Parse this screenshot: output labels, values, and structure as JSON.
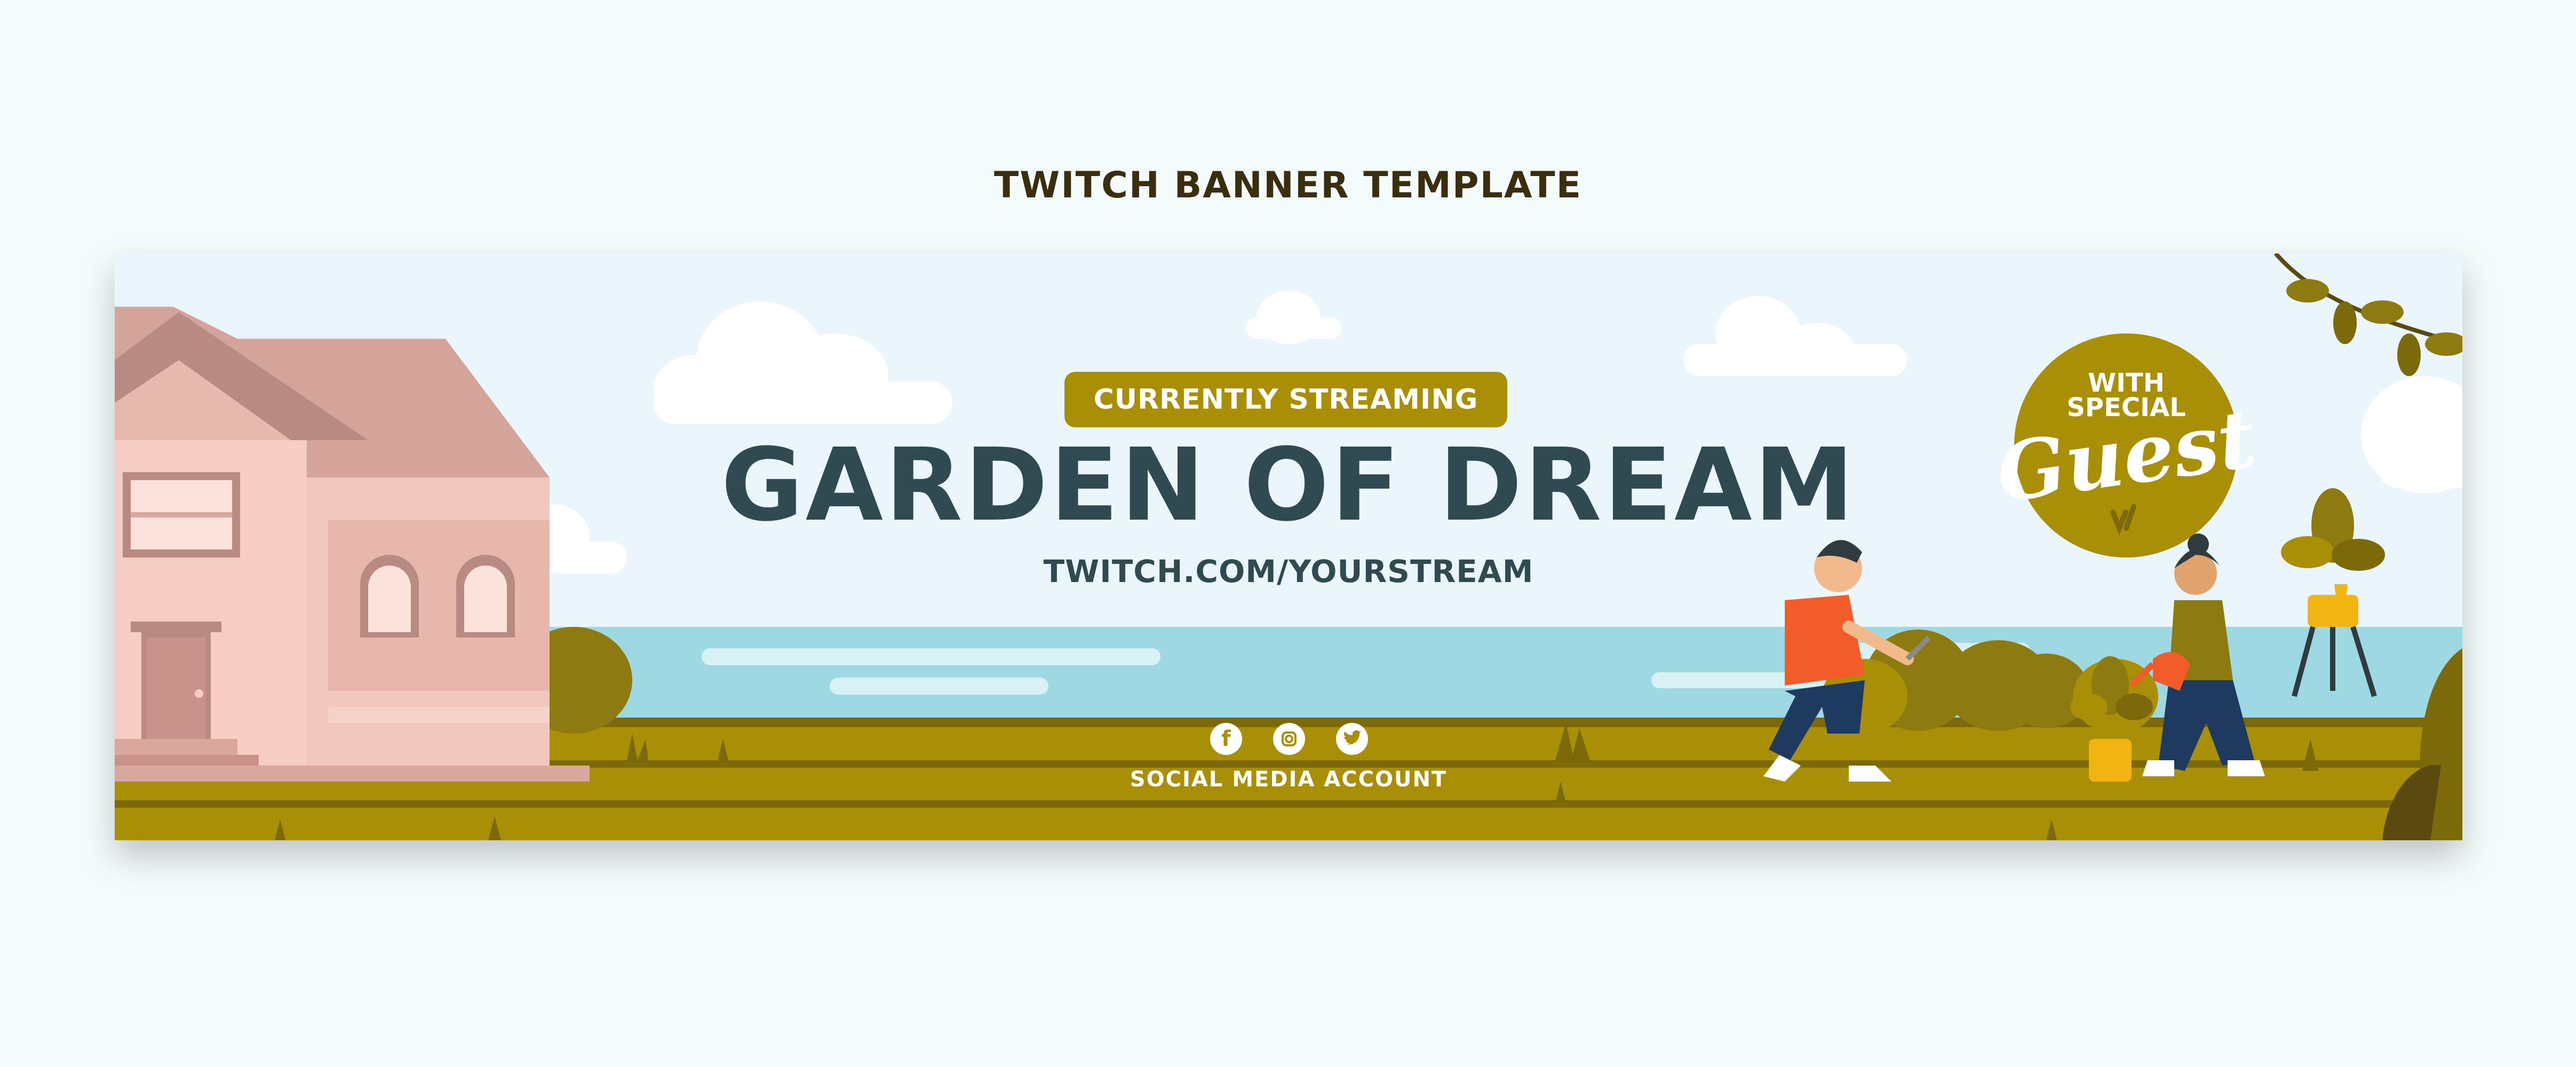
{
  "page": {
    "title": "TWITCH BANNER TEMPLATE"
  },
  "banner": {
    "status_label": "CURRENTLY STREAMING",
    "headline": "GARDEN OF DREAM",
    "url": "TWITCH.COM/YOURSTREAM",
    "social_label": "SOCIAL MEDIA ACCOUNT",
    "social_icons": [
      "facebook-icon",
      "instagram-icon",
      "twitter-icon"
    ],
    "badge": {
      "line1": "WITH",
      "line2": "SPECIAL",
      "script": "Guest"
    }
  },
  "colors": {
    "background": "#f4fbfb",
    "sky": "#eaf6fb",
    "sea": "#9dd8e3",
    "grass": "#a98f06",
    "accent": "#a98f06",
    "headline": "#2f4a50",
    "house": "#f1c6bc",
    "roof": "#d4a39a"
  }
}
